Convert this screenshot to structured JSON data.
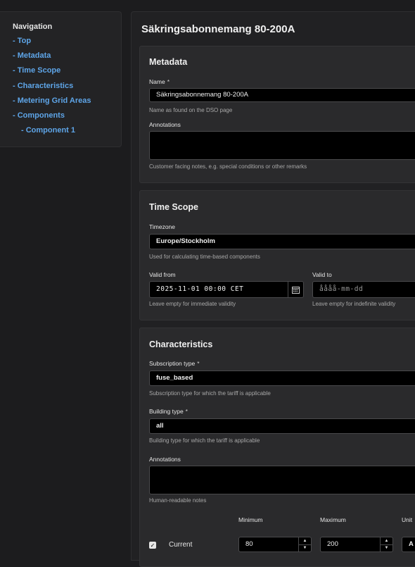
{
  "nav": {
    "title": "Navigation",
    "items": [
      {
        "label": "- Top"
      },
      {
        "label": "- Metadata"
      },
      {
        "label": "- Time Scope"
      },
      {
        "label": "- Characteristics"
      },
      {
        "label": "- Metering Grid Areas"
      },
      {
        "label": "- Components"
      },
      {
        "label": "- Component 1"
      }
    ]
  },
  "page_title": "Säkringsabonnemang 80-200A",
  "metadata": {
    "title": "Metadata",
    "name_label": "Name",
    "required_mark": "*",
    "name_value": "Säkringsabonnemang 80-200A",
    "name_hint": "Name as found on the DSO page",
    "annotations_label": "Annotations",
    "annotations_hint": "Customer facing notes, e.g. special conditions or other remarks"
  },
  "time_scope": {
    "title": "Time Scope",
    "timezone_label": "Timezone",
    "timezone_value": "Europe/Stockholm",
    "timezone_hint": "Used for calculating time-based components",
    "valid_from_label": "Valid from",
    "valid_from_value": "2025-11-01 00:00 CET",
    "valid_from_hint": "Leave empty for immediate validity",
    "valid_to_label": "Valid to",
    "valid_to_placeholder": "åååå-mm-dd",
    "valid_to_hint": "Leave empty for indefinite validity"
  },
  "characteristics": {
    "title": "Characteristics",
    "subscription_label": "Subscription type",
    "subscription_value": "fuse_based",
    "subscription_hint": "Subscription type for which the tariff is applicable",
    "building_label": "Building type",
    "building_value": "all",
    "building_hint": "Building type for which the tariff is applicable",
    "annotations_label": "Annotations",
    "annotations_hint": "Human-readable notes",
    "current_label": "Current",
    "current_checked": true,
    "min_label": "Minimum",
    "min_value": "80",
    "max_label": "Maximum",
    "max_value": "200",
    "unit_label": "Unit",
    "unit_value": "A"
  }
}
